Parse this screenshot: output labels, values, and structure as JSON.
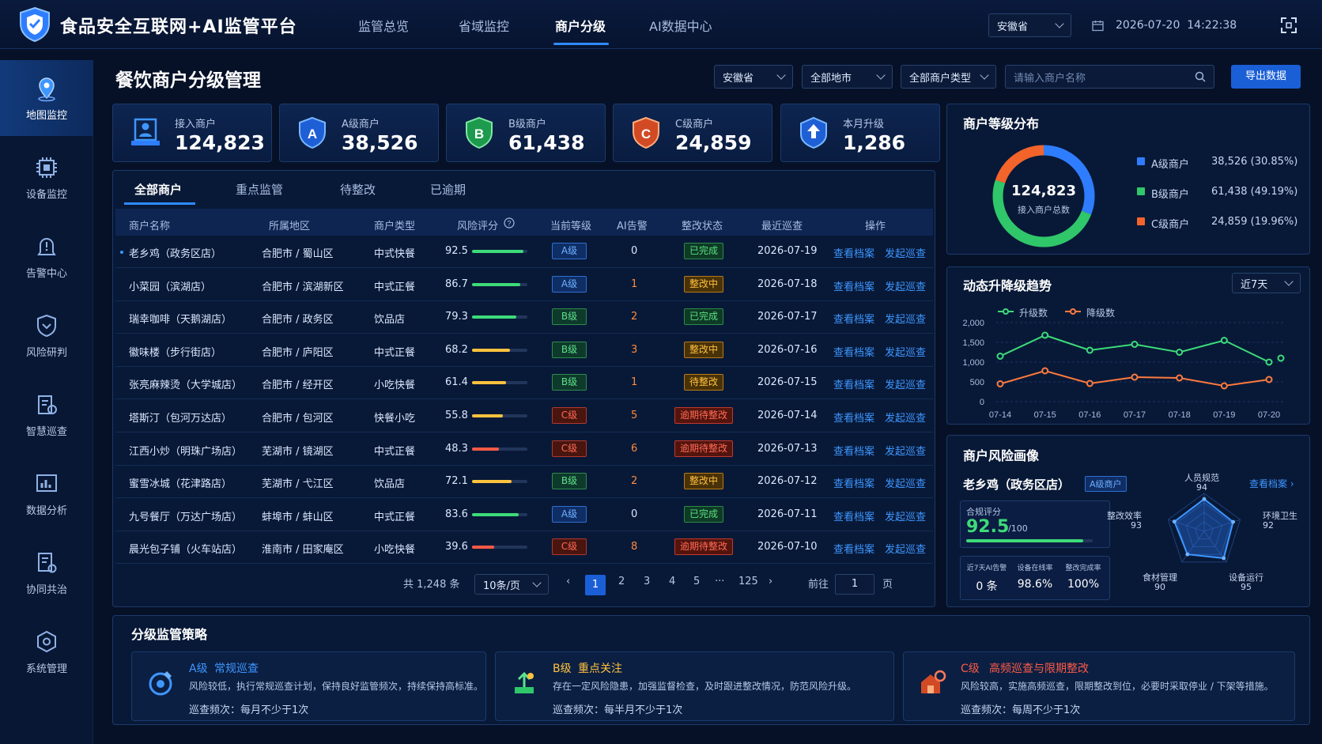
{
  "header": {
    "title": "食品安全互联网+AI监管平台",
    "nav": [
      "监管总览",
      "省域监控",
      "商户分级",
      "AI数据中心"
    ],
    "province": "安徽省",
    "datetime": "2026-07-20  14:22:38"
  },
  "sidebar": [
    "地图监控",
    "设备监控",
    "告警中心",
    "风险研判",
    "智慧巡查",
    "数据分析",
    "协同共治",
    "系统管理"
  ],
  "page": {
    "title": "餐饮商户分级管理",
    "filters": [
      "安徽省",
      "全部地市",
      "全部商户类型"
    ],
    "search_placeholder": "请输入商户名称",
    "export": "导出数据"
  },
  "stats": [
    {
      "label": "接入商户",
      "value": "124,823"
    },
    {
      "label": "A级商户",
      "value": "38,526"
    },
    {
      "label": "B级商户",
      "value": "61,438"
    },
    {
      "label": "C级商户",
      "value": "24,859"
    },
    {
      "label": "本月升级",
      "value": "1,286"
    }
  ],
  "tabs": [
    "全部商户",
    "重点监管",
    "待整改",
    "已逾期"
  ],
  "table": {
    "headers": [
      "商户名称",
      "所属地区",
      "商户类型",
      "风险评分",
      "当前等级",
      "AI告警",
      "整改状态",
      "最近巡查",
      "操作"
    ],
    "rows": [
      {
        "name": "老乡鸡（政务区店）",
        "region": "合肥市 / 蜀山区",
        "type": "中式快餐",
        "score": "92.5",
        "level": "A级",
        "alerts": "0",
        "status": "已完成",
        "date": "2026-07-19"
      },
      {
        "name": "小菜园（滨湖店）",
        "region": "合肥市 / 滨湖新区",
        "type": "中式正餐",
        "score": "86.7",
        "level": "A级",
        "alerts": "1",
        "status": "整改中",
        "date": "2026-07-18"
      },
      {
        "name": "瑞幸咖啡（天鹅湖店）",
        "region": "合肥市 / 政务区",
        "type": "饮品店",
        "score": "79.3",
        "level": "B级",
        "alerts": "2",
        "status": "已完成",
        "date": "2026-07-17"
      },
      {
        "name": "徽味楼（步行街店）",
        "region": "合肥市 / 庐阳区",
        "type": "中式正餐",
        "score": "68.2",
        "level": "B级",
        "alerts": "3",
        "status": "整改中",
        "date": "2026-07-16"
      },
      {
        "name": "张亮麻辣烫（大学城店）",
        "region": "合肥市 / 经开区",
        "type": "小吃快餐",
        "score": "61.4",
        "level": "B级",
        "alerts": "1",
        "status": "待整改",
        "date": "2026-07-15"
      },
      {
        "name": "塔斯汀（包河万达店）",
        "region": "合肥市 / 包河区",
        "type": "快餐小吃",
        "score": "55.8",
        "level": "C级",
        "alerts": "5",
        "status": "逾期待整改",
        "date": "2026-07-14"
      },
      {
        "name": "江西小炒（明珠广场店）",
        "region": "芜湖市 / 镜湖区",
        "type": "中式正餐",
        "score": "48.3",
        "level": "C级",
        "alerts": "6",
        "status": "逾期待整改",
        "date": "2026-07-13"
      },
      {
        "name": "蜜雪冰城（花津路店）",
        "region": "芜湖市 / 弋江区",
        "type": "饮品店",
        "score": "72.1",
        "level": "B级",
        "alerts": "2",
        "status": "整改中",
        "date": "2026-07-12"
      },
      {
        "name": "九号餐厅（万达广场店）",
        "region": "蚌埠市 / 蚌山区",
        "type": "中式正餐",
        "score": "83.6",
        "level": "A级",
        "alerts": "0",
        "status": "已完成",
        "date": "2026-07-11"
      },
      {
        "name": "晨光包子铺（火车站店）",
        "region": "淮南市 / 田家庵区",
        "type": "小吃快餐",
        "score": "39.6",
        "level": "C级",
        "alerts": "8",
        "status": "逾期待整改",
        "date": "2026-07-10"
      }
    ],
    "action1": "查看档案",
    "action2": "发起巡查"
  },
  "pagination": {
    "total": "共 1,248 条",
    "per_page": "10条/页",
    "pages": [
      "1",
      "2",
      "3",
      "4",
      "5",
      "···",
      "125"
    ],
    "goto_label": "前往",
    "goto_value": "1",
    "page_unit": "页"
  },
  "distribution": {
    "title": "商户等级分布",
    "center_value": "124,823",
    "center_label": "接入商户总数",
    "items": [
      {
        "label": "A级商户",
        "value": "38,526 (30.85%)",
        "color": "#2f7dff"
      },
      {
        "label": "B级商户",
        "value": "61,438 (49.19%)",
        "color": "#2fc76a"
      },
      {
        "label": "C级商户",
        "value": "24,859 (19.96%)",
        "color": "#f2642a"
      }
    ]
  },
  "trend": {
    "title": "动态升降级趋势",
    "range": "近7天",
    "legend_up": "升级数",
    "legend_down": "降级数",
    "chart_data": {
      "type": "line",
      "x": [
        "07-14",
        "07-15",
        "07-16",
        "07-17",
        "07-18",
        "07-19",
        "07-20"
      ],
      "ylim": [
        0,
        2000
      ],
      "yticks": [
        "2,000",
        "1,500",
        "1,000",
        "500",
        "0"
      ],
      "series": [
        {
          "name": "升级数",
          "values": [
            1150,
            1680,
            1300,
            1450,
            1250,
            1550,
            1000,
            1100
          ],
          "color": "#3ddb79"
        },
        {
          "name": "降级数",
          "values": [
            450,
            780,
            460,
            620,
            600,
            400,
            560
          ],
          "color": "#ff7a3d"
        }
      ]
    }
  },
  "risk": {
    "title": "商户风险画像",
    "merchant": "老乡鸡（政务区店）",
    "badge": "A级商户",
    "link": "查看档案 ›",
    "score_label": "合规评分",
    "score": "92.5",
    "score_unit": "/100",
    "score_pct": 92.5,
    "metrics": [
      {
        "label": "近7天AI告警",
        "value": "0 条"
      },
      {
        "label": "设备在线率",
        "value": "98.6%"
      },
      {
        "label": "整改完成率",
        "value": "100%"
      }
    ],
    "radar": [
      {
        "label": "人员规范",
        "value": "94"
      },
      {
        "label": "环境卫生",
        "value": "92"
      },
      {
        "label": "设备运行",
        "value": "95"
      },
      {
        "label": "食材管理",
        "value": "90"
      },
      {
        "label": "整改效率",
        "value": "93"
      }
    ]
  },
  "strategy": {
    "title": "分级监管策略",
    "items": [
      {
        "level": "A级",
        "name": "常规巡查",
        "desc": "风险较低，执行常规巡查计划，保持良好监管频次，持续保持高标准。",
        "freq": "巡查频次：每月不少于1次",
        "color": "#3e96ff"
      },
      {
        "level": "B级",
        "name": "重点关注",
        "desc": "存在一定风险隐患，加强监督检查，及时跟进整改情况，防范风险升级。",
        "freq": "巡查频次：每半月不少于1次",
        "color": "#ffc23d"
      },
      {
        "level": "C级",
        "name": "高频巡查与限期整改",
        "desc": "风险较高，实施高频巡查，限期整改到位，必要时采取停业 / 下架等措施。",
        "freq": "巡查频次：每周不少于1次",
        "color": "#ff5a45"
      }
    ]
  }
}
